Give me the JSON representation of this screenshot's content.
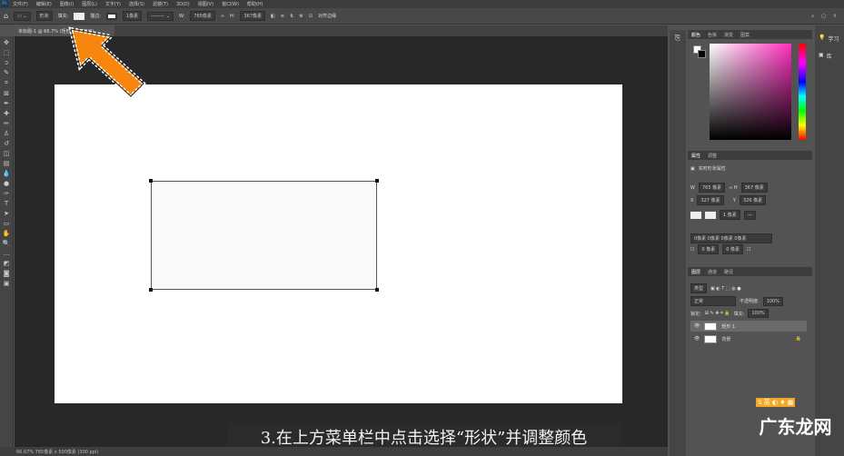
{
  "menu": [
    "文件(F)",
    "编辑(E)",
    "图像(I)",
    "图层(L)",
    "文字(Y)",
    "选择(S)",
    "滤镜(T)",
    "3D(D)",
    "视图(V)",
    "窗口(W)",
    "帮助(H)"
  ],
  "options": {
    "mode": "形状",
    "fill_label": "填充:",
    "stroke_label": "描边:",
    "stroke_width": "1像素",
    "w_label": "W:",
    "w": "765像素",
    "h_label": "H:",
    "h": "367像素",
    "align_edges": "对齐边缘"
  },
  "tab": {
    "title": "未标题-1 @ 66.7% (矩形 1, RGB/8)"
  },
  "canvas": {
    "caption": "3.在上方菜单栏中点击选择“形状”并调整颜色"
  },
  "status": {
    "text": "66.67%  765像素 x 500像素 (300 ppi)"
  },
  "color_panel": {
    "tabs": [
      "颜色",
      "色板",
      "渐变",
      "图案"
    ]
  },
  "properties": {
    "tabs": [
      "属性",
      "调整"
    ],
    "type": "实时形状属性",
    "w": "765 像素",
    "h": "367 像素",
    "x": "327 像素",
    "y": "326 像素",
    "stroke": "1 像素",
    "corners": "0像素 0像素 0像素 0像素",
    "r1": "0 像素",
    "r2": "0 像素"
  },
  "layers": {
    "tabs": [
      "图层",
      "通道",
      "路径"
    ],
    "filter": "类型",
    "blend": "正常",
    "opacity_label": "不透明度:",
    "opacity": "100%",
    "lock_label": "锁定:",
    "fill_label": "填充:",
    "fill": "100%",
    "items": [
      {
        "name": "矩形 1"
      },
      {
        "name": "背景"
      }
    ]
  },
  "farright": {
    "items": [
      "学习",
      "库"
    ]
  },
  "watermark": "广东龙网"
}
